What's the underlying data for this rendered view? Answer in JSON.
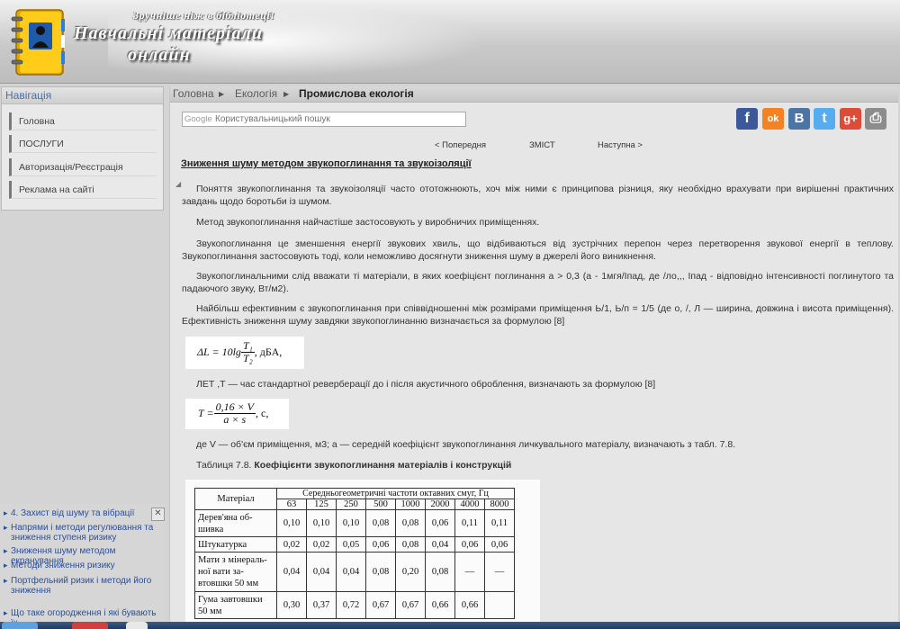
{
  "header": {
    "tagline": "Зручніше ніж в бібліотеці!",
    "title_line1": "Навчальні матеріали",
    "title_line2": "онлайн"
  },
  "navigation": {
    "title": "Навігація",
    "items": [
      "Головна",
      "ПОСЛУГИ",
      "Авторизація/Реєстрація",
      "Реклама на сайті"
    ]
  },
  "related": {
    "close_label": "✕",
    "items": [
      "4. Захист від шуму та вібрації",
      "Напрями і методи регулювання та зниження ступеня ризику",
      "Зниження шуму методом екранування",
      "Методи зниження ризику",
      "Портфельний ризик і методи його зниження",
      "Що таке огородження і які бувають їх"
    ]
  },
  "breadcrumb": {
    "items": [
      "Головна",
      "Екологія"
    ],
    "current": "Промислова екологія"
  },
  "search": {
    "provider": "Google",
    "placeholder": "Користувальницький пошук"
  },
  "share_icons": [
    "facebook-icon",
    "odnoklassniki-icon",
    "vkontakte-icon",
    "twitter-icon",
    "google-plus-icon",
    "print-icon"
  ],
  "share_glyphs": [
    "f",
    "ok",
    "B",
    "t",
    "g+",
    "⎙"
  ],
  "share_colors": [
    "#3b5998",
    "#f58220",
    "#4c75a3",
    "#55acee",
    "#dd4b39",
    "#8c8c8c"
  ],
  "pager": {
    "prev": "< Попередня",
    "toc": "ЗМІСТ",
    "next": "Наступна >"
  },
  "article": {
    "title": "Зниження шуму методом звукопоглинання та звукоізоляції",
    "paragraphs": [
      "Поняття звукопоглинання та звукоізоляції часто ототожнюють, хоч між ними є принципова різниця, яку необхідно врахувати при вирішенні практичних завдань щодо боротьби із шумом.",
      "Метод звукопоглинання найчастіше застосовують у виробничих приміщеннях.",
      "Звукопоглинання це зменшення енергії звукових хвиль, що відбиваються від зустрічних перепон через перетворення звукової енергії в теплову. Звукопоглинання застосовують тоді, коли неможливо досягнути зниження шуму в джерелі його виникнення.",
      "Звукопоглинальними слід вважати ті матеріали, в яких коефіцієнт поглинання а > 0,3 (а - 1мгя/Іпад, де /ло,,, Іпад - відповідно інтенсивності поглинутого та падаючого звуку, Вт/м2).",
      "Найбільш ефективним є звукопоглинання при співвідношенні між розмірами приміщення Ь/1, Ь/п = 1/5 (де о, /, Л — ширина, довжина і висота приміщення). Ефективність зниження шуму завдяки звукопоглинанню визначається за формулою [8]",
      "ЛЕТ ,Т — час стандартної реверберації до і після акустичного оброблення, визначають за формулою [8]",
      "де V — об'єм приміщення, м3; а — середній коефіцієнт звукопоглинання личкувального матеріалу, визначають з табл. 7.8."
    ],
    "table_caption_prefix": "Таблиця 7.8. ",
    "table_caption_bold": "Коефіцієнти звукопоглинання матеріалів і конструкцій"
  },
  "formula1": {
    "lhs": "ΔL = 10lg",
    "num": "T₁",
    "den": "T₂",
    "unit": ", дБА,"
  },
  "formula2": {
    "lhs": "T =",
    "num": "0,16 × V",
    "den": "a × s",
    "unit": ", с,"
  },
  "table": {
    "header_material": "Матеріал",
    "header_freq": "Середньогеометричні частоти октавних смуг, Гц",
    "freqs": [
      "63",
      "125",
      "250",
      "500",
      "1000",
      "2000",
      "4000",
      "8000"
    ],
    "rows": [
      {
        "material": "Дерев'яна об-шивка",
        "values": [
          "0,10",
          "0,10",
          "0,10",
          "0,08",
          "0,08",
          "0,06",
          "0,11",
          "0,11"
        ]
      },
      {
        "material": "Штукатурка",
        "values": [
          "0,02",
          "0,02",
          "0,05",
          "0,06",
          "0,08",
          "0,04",
          "0,06",
          "0,06"
        ]
      },
      {
        "material": "Мати з мінераль-ної вати за-втовшки 50 мм",
        "values": [
          "0,04",
          "0,04",
          "0,04",
          "0,08",
          "0,20",
          "0,08",
          "—",
          "—"
        ]
      },
      {
        "material": "Гума завтовшки 50 мм",
        "values": [
          "0,30",
          "0,37",
          "0,72",
          "0,67",
          "0,67",
          "0,66",
          "0,66",
          ""
        ]
      }
    ]
  }
}
